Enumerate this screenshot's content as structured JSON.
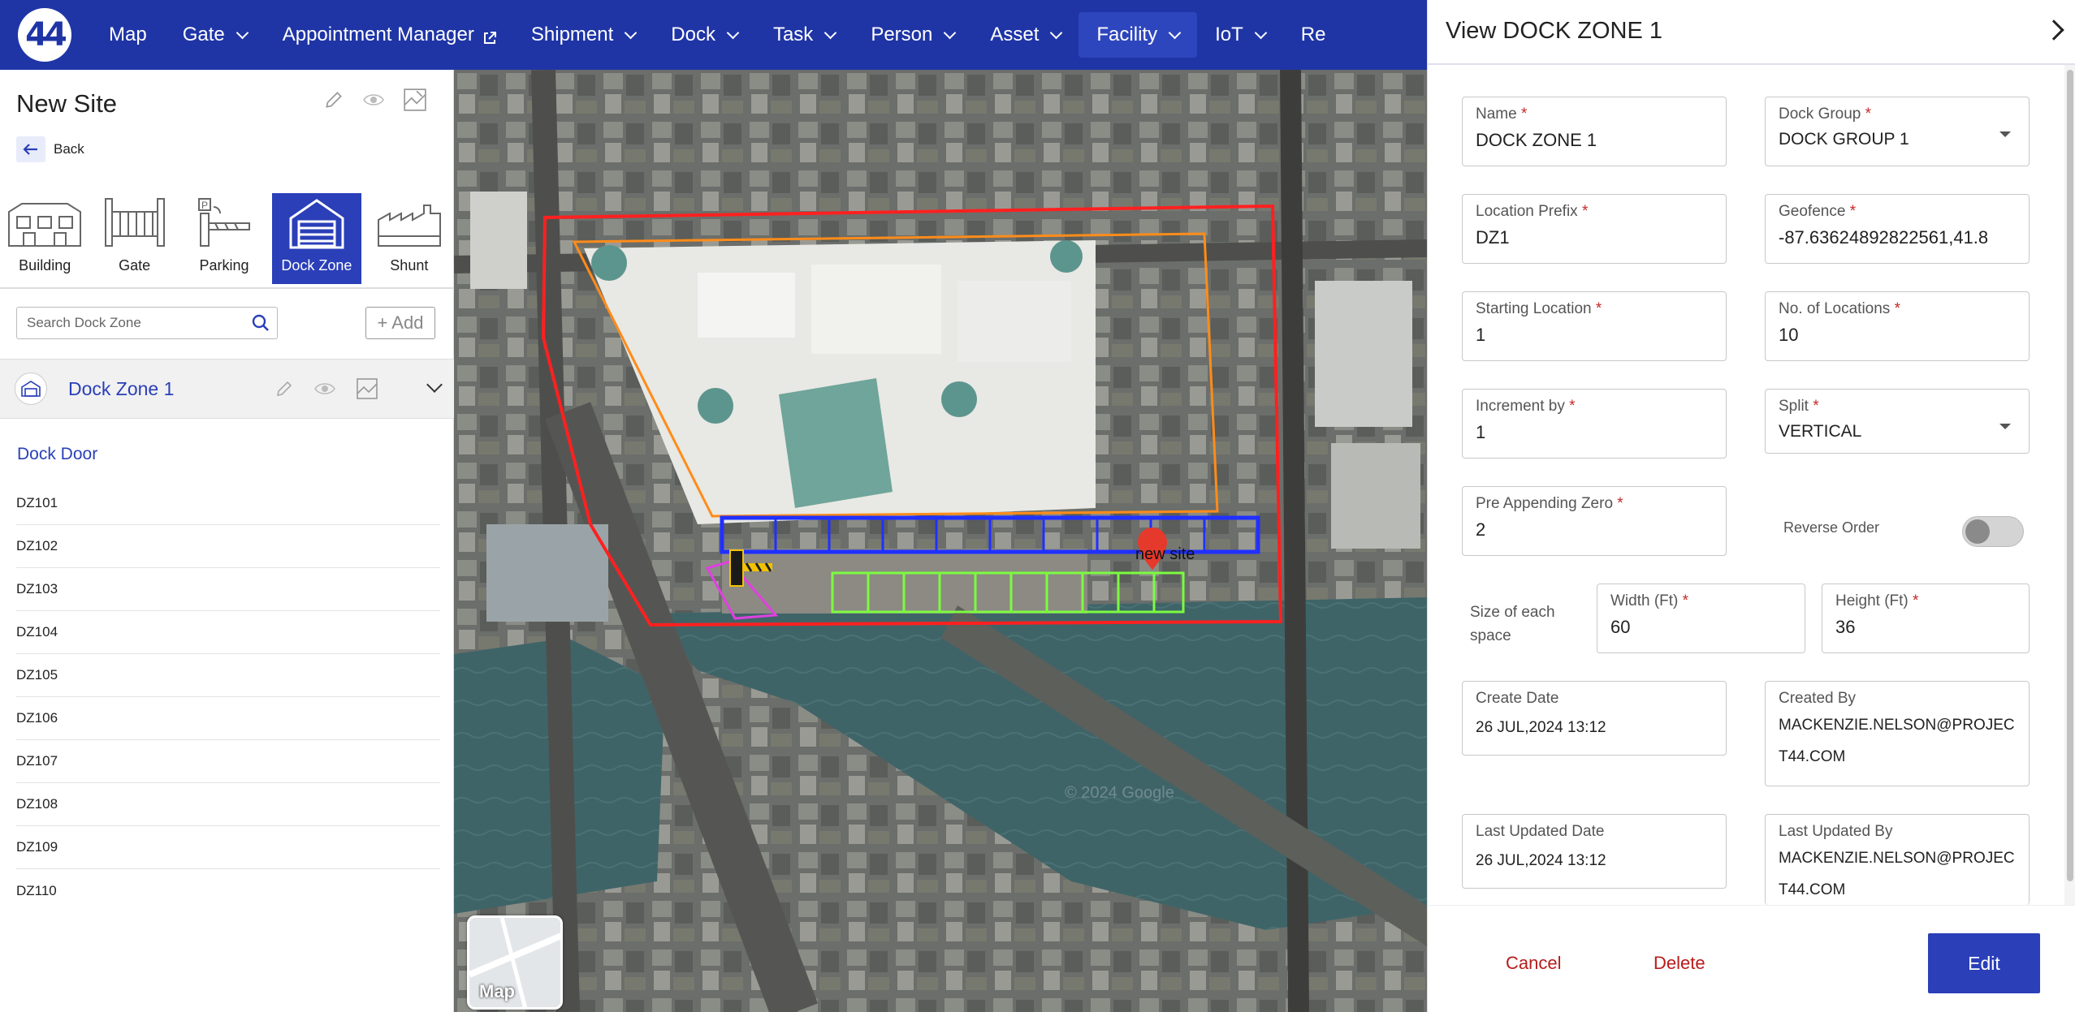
{
  "nav": {
    "logo_text": "44",
    "items": [
      {
        "label": "Map",
        "chevron": false,
        "external": false,
        "active": false
      },
      {
        "label": "Gate",
        "chevron": true,
        "external": false,
        "active": false
      },
      {
        "label": "Appointment Manager",
        "chevron": false,
        "external": true,
        "active": false
      },
      {
        "label": "Shipment",
        "chevron": true,
        "external": false,
        "active": false
      },
      {
        "label": "Dock",
        "chevron": true,
        "external": false,
        "active": false
      },
      {
        "label": "Task",
        "chevron": true,
        "external": false,
        "active": false
      },
      {
        "label": "Person",
        "chevron": true,
        "external": false,
        "active": false
      },
      {
        "label": "Asset",
        "chevron": true,
        "external": false,
        "active": false
      },
      {
        "label": "Facility",
        "chevron": true,
        "external": false,
        "active": true
      },
      {
        "label": "IoT",
        "chevron": true,
        "external": false,
        "active": false
      },
      {
        "label": "Re",
        "chevron": false,
        "external": false,
        "active": false
      }
    ]
  },
  "left": {
    "site_title": "New Site",
    "back_label": "Back",
    "categories": [
      {
        "label": "Building",
        "icon": "building-icon"
      },
      {
        "label": "Gate",
        "icon": "gate-icon"
      },
      {
        "label": "Parking",
        "icon": "parking-icon"
      },
      {
        "label": "Dock Zone",
        "icon": "dock-zone-icon"
      },
      {
        "label": "Shunt",
        "icon": "shunt-icon"
      }
    ],
    "active_category": "Dock Zone",
    "search_placeholder": "Search Dock Zone",
    "add_label": "+ Add",
    "zone_name": "Dock Zone 1",
    "door_section_title": "Dock Door",
    "doors": [
      "DZ101",
      "DZ102",
      "DZ103",
      "DZ104",
      "DZ105",
      "DZ106",
      "DZ107",
      "DZ108",
      "DZ109",
      "DZ110"
    ]
  },
  "map": {
    "pin_label": "new site",
    "thumb_label": "Map",
    "watermark": "© 2024 Google"
  },
  "drawer": {
    "title": "View DOCK ZONE 1",
    "name_label": "Name",
    "name_value": "DOCK ZONE 1",
    "dock_group_label": "Dock Group",
    "dock_group_value": "DOCK GROUP 1",
    "location_prefix_label": "Location Prefix",
    "location_prefix_value": "DZ1",
    "geofence_label": "Geofence",
    "geofence_value": "-87.63624892822561,41.8",
    "starting_location_label": "Starting Location",
    "starting_location_value": "1",
    "no_locations_label": "No. of Locations",
    "no_locations_value": "10",
    "increment_label": "Increment by",
    "increment_value": "1",
    "split_label": "Split",
    "split_value": "VERTICAL",
    "pre_zero_label": "Pre Appending Zero",
    "pre_zero_value": "2",
    "reverse_order_label": "Reverse Order",
    "reverse_order_on": false,
    "size_label": "Size of each space",
    "width_label": "Width (Ft)",
    "width_value": "60",
    "height_label": "Height (Ft)",
    "height_value": "36",
    "create_date_label": "Create Date",
    "create_date_value": "26 JUL,2024 13:12",
    "created_by_label": "Created By",
    "created_by_value": "MACKENZIE.NELSON@PROJECT44.COM",
    "updated_date_label": "Last Updated Date",
    "updated_date_value": "26 JUL,2024 13:12",
    "updated_by_label": "Last Updated By",
    "updated_by_value": "MACKENZIE.NELSON@PROJECT44.COM",
    "required_mark": "*",
    "cancel_label": "Cancel",
    "delete_label": "Delete",
    "edit_label": "Edit"
  },
  "colors": {
    "brand": "#1f35a6",
    "accent": "#2a3fb8",
    "danger": "#b71c1c",
    "site_outline": "#ff2020",
    "building_outline": "#ff8c1a",
    "dock_zone_outline": "#2030ff",
    "parking_outline": "#7cfc40",
    "gate_outline": "#e040e0"
  }
}
